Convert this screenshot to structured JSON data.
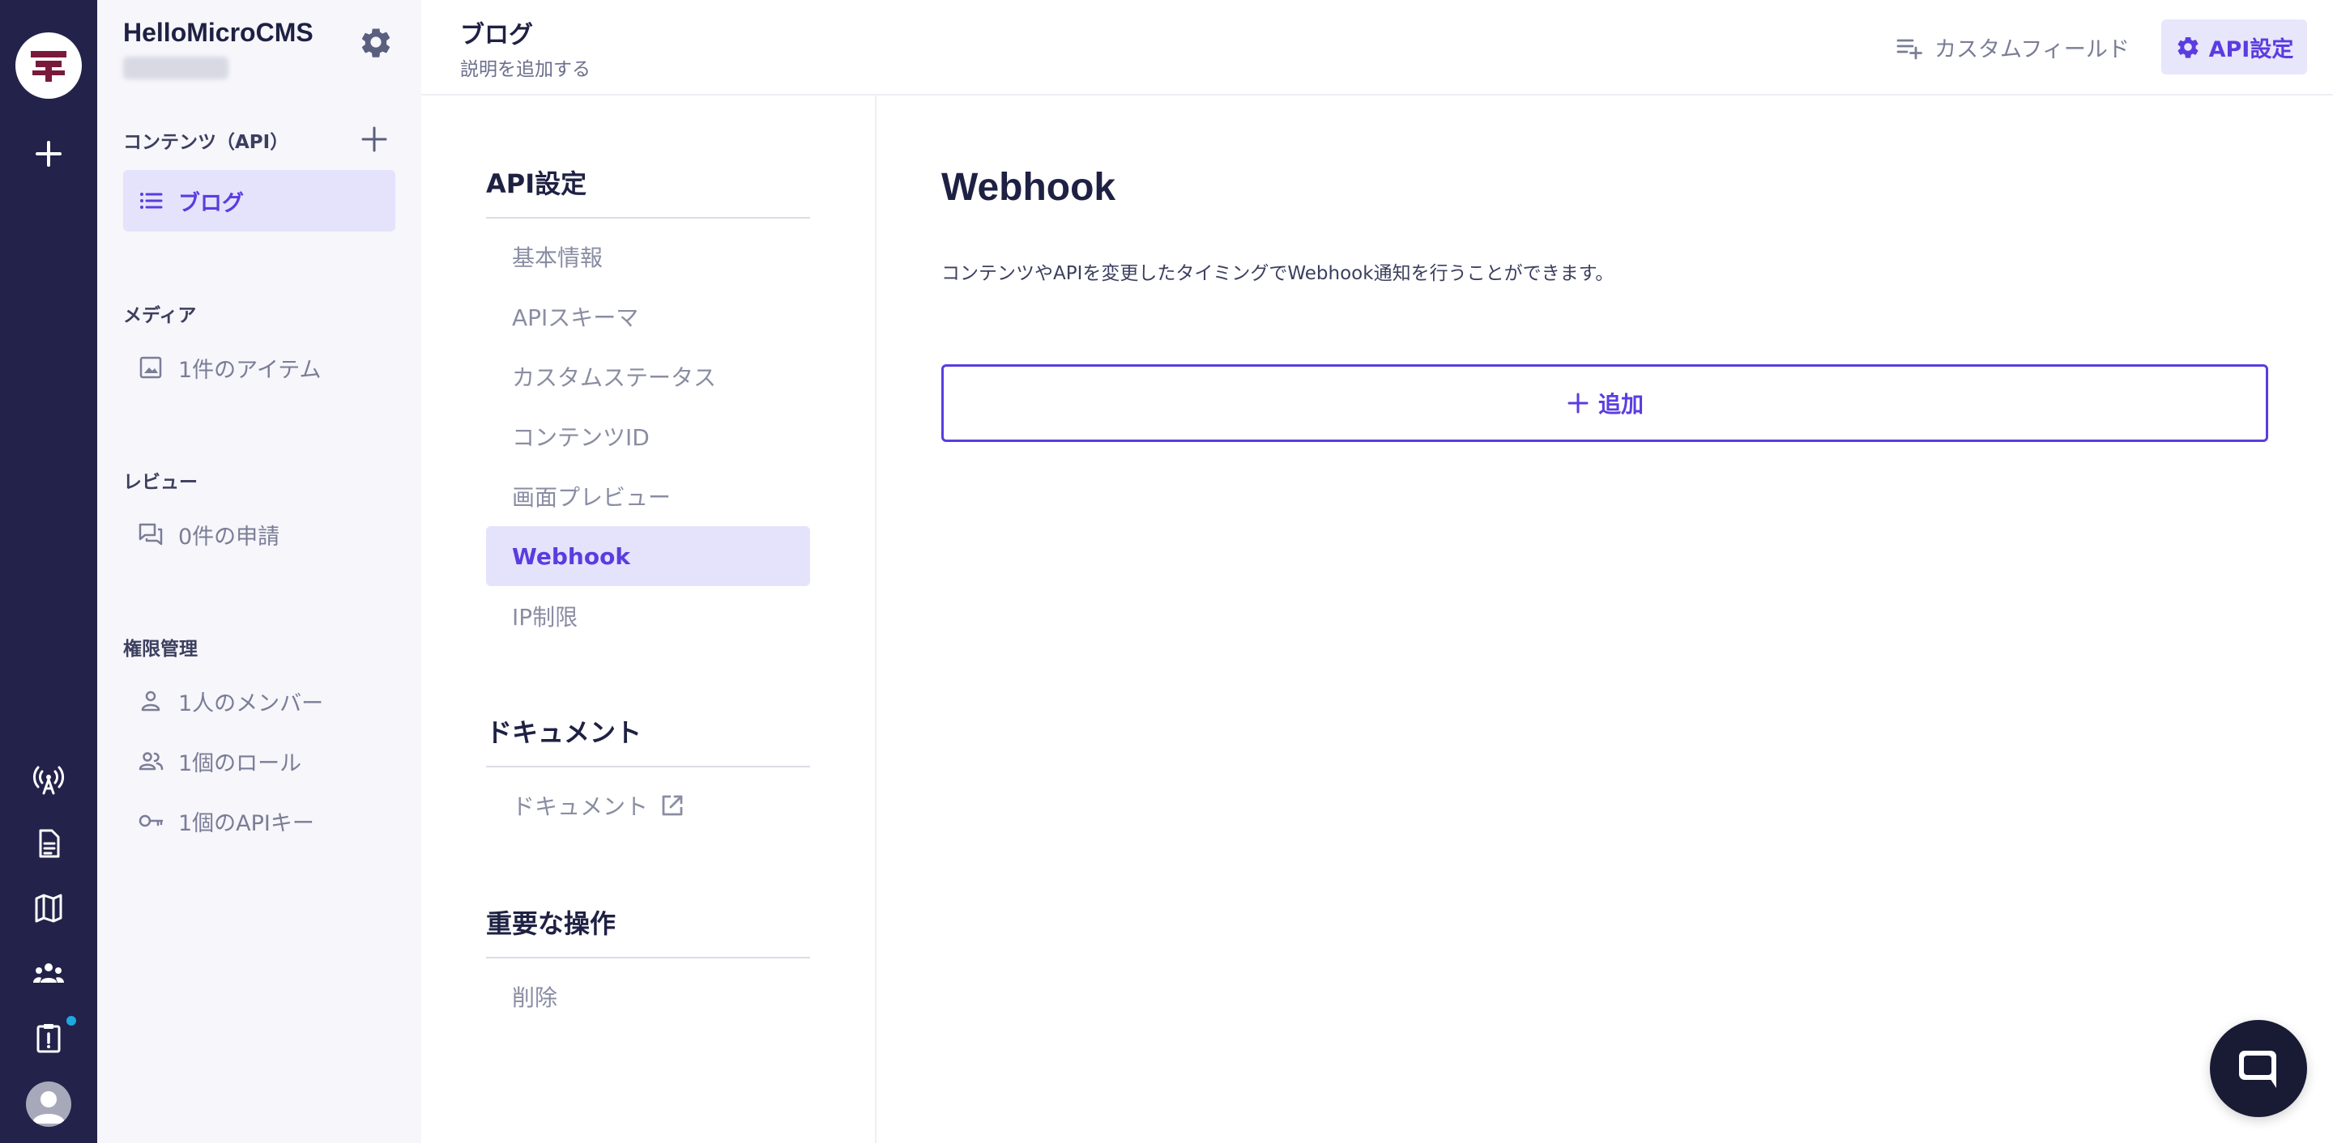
{
  "app": {
    "service_name": "HelloMicroCMS"
  },
  "rail": {
    "icons": [
      "logo-icon",
      "add-icon",
      "antenna-icon",
      "document-icon",
      "map-icon",
      "team-icon",
      "clipboard-alert-icon",
      "avatar-icon"
    ],
    "notification_color": "#1fa7e1"
  },
  "sidebar": {
    "contents_label": "コンテンツ（API）",
    "contents_items": [
      {
        "label": "ブログ",
        "icon": "list-icon",
        "active": true
      }
    ],
    "media_label": "メディア",
    "media_items": [
      {
        "label": "1件のアイテム",
        "icon": "image-icon"
      }
    ],
    "review_label": "レビュー",
    "review_items": [
      {
        "label": "0件の申請",
        "icon": "forum-icon"
      }
    ],
    "permissions_label": "権限管理",
    "permissions_items": [
      {
        "label": "1人のメンバー",
        "icon": "person-icon"
      },
      {
        "label": "1個のロール",
        "icon": "people-icon"
      },
      {
        "label": "1個のAPIキー",
        "icon": "key-icon"
      }
    ]
  },
  "header": {
    "title": "ブログ",
    "description_placeholder": "説明を追加する",
    "custom_field_label": "カスタムフィールド",
    "api_settings_label": "API設定"
  },
  "settings_menu": {
    "api_settings_heading": "API設定",
    "api_settings_items": [
      {
        "label": "基本情報",
        "active": false
      },
      {
        "label": "APIスキーマ",
        "active": false
      },
      {
        "label": "カスタムステータス",
        "active": false
      },
      {
        "label": "コンテンツID",
        "active": false
      },
      {
        "label": "画面プレビュー",
        "active": false
      },
      {
        "label": "Webhook",
        "active": true
      },
      {
        "label": "IP制限",
        "active": false
      }
    ],
    "document_heading": "ドキュメント",
    "document_link_label": "ドキュメント",
    "danger_heading": "重要な操作",
    "delete_label": "削除"
  },
  "main": {
    "heading": "Webhook",
    "description": "コンテンツやAPIを変更したタイミングでWebhook通知を行うことができます。",
    "add_button_label": "追加"
  },
  "colors": {
    "accent": "#5b3ce0",
    "accent_bg": "#e5e3fb",
    "rail_bg": "#22224a",
    "sidebar_bg": "#f6f6fb"
  }
}
